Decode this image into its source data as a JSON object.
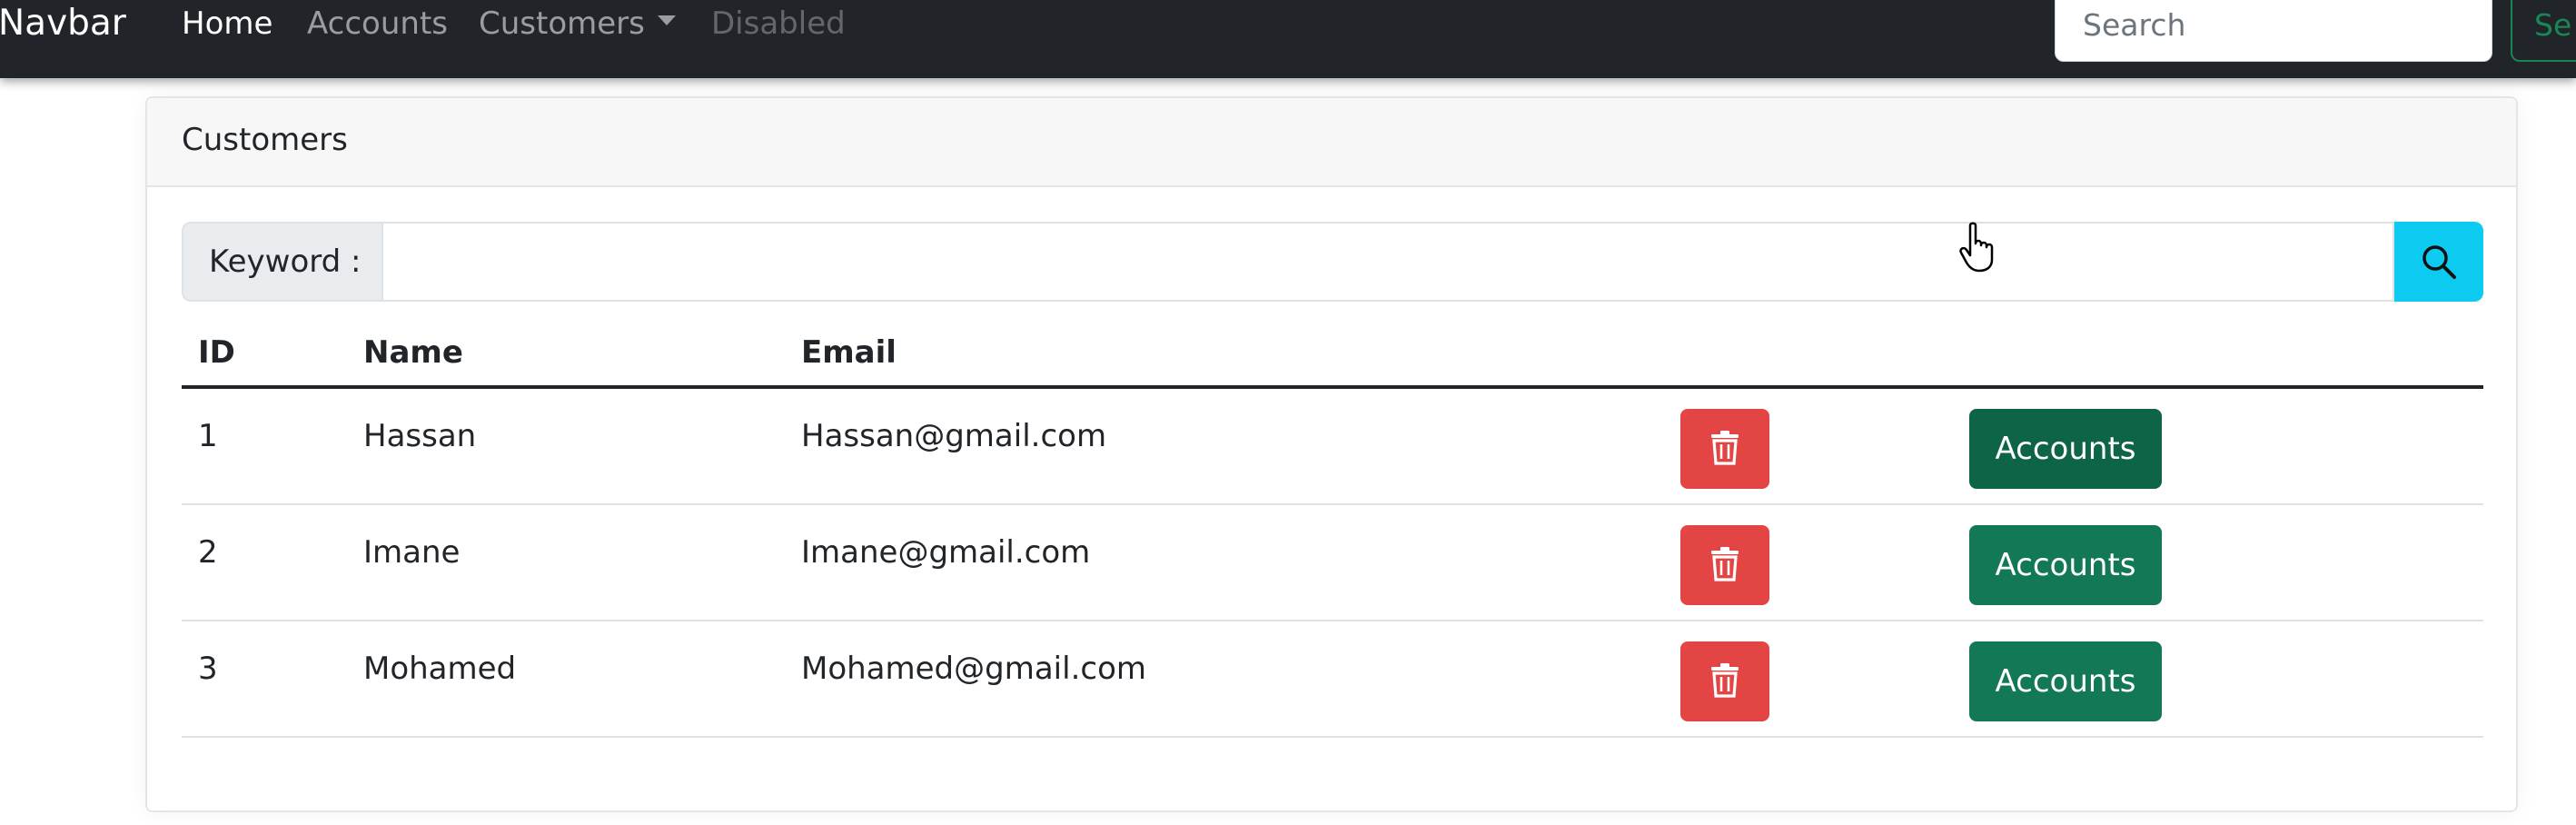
{
  "navbar": {
    "brand": "Navbar",
    "links": [
      {
        "label": "Home",
        "state": "active"
      },
      {
        "label": "Accounts",
        "state": "normal"
      },
      {
        "label": "Customers",
        "state": "dropdown"
      },
      {
        "label": "Disabled",
        "state": "disabled"
      }
    ],
    "search_placeholder": "Search",
    "search_button": "Se"
  },
  "card": {
    "title": "Customers",
    "keyword_label": "Keyword :",
    "keyword_value": "",
    "search_icon": "search-icon"
  },
  "table": {
    "headers": [
      "ID",
      "Name",
      "Email"
    ],
    "rows": [
      {
        "id": "1",
        "name": "Hassan",
        "email": "Hassan@gmail.com",
        "accounts_label": "Accounts"
      },
      {
        "id": "2",
        "name": "Imane",
        "email": "Imane@gmail.com",
        "accounts_label": "Accounts"
      },
      {
        "id": "3",
        "name": "Mohamed",
        "email": "Mohamed@gmail.com",
        "accounts_label": "Accounts"
      }
    ],
    "delete_icon": "trash-icon"
  },
  "colors": {
    "navbar_bg": "#212529",
    "delete": "#e34444",
    "accounts": "#127856",
    "search_accent": "#0dcaf0"
  }
}
